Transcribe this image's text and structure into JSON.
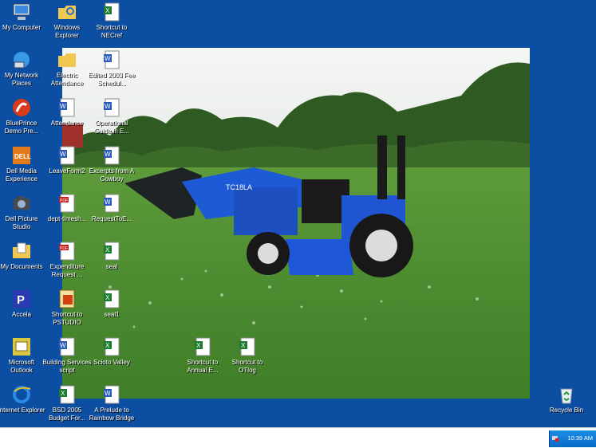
{
  "desktop": {
    "background_color": "#0c4ea2",
    "icons": [
      {
        "id": "my-computer",
        "label": "My Computer",
        "icon": "computer-icon"
      },
      {
        "id": "windows-explorer",
        "label": "Windows Explorer",
        "icon": "explorer-icon"
      },
      {
        "id": "shortcut-necref",
        "label": "Shortcut to NECref",
        "icon": "excel-icon"
      },
      {
        "id": "my-network-places",
        "label": "My Network Places",
        "icon": "network-icon"
      },
      {
        "id": "electric-attendance",
        "label": "Electric Attendance",
        "icon": "folder-icon"
      },
      {
        "id": "edited-2003",
        "label": "Edited 2003 Fee Schedul...",
        "icon": "word-icon"
      },
      {
        "id": "blueprince",
        "label": "BluePrince Demo Pre...",
        "icon": "blueprince-icon"
      },
      {
        "id": "attendance",
        "label": "Attendance",
        "icon": "word-icon"
      },
      {
        "id": "operational-guide",
        "label": "Operational Guide in E...",
        "icon": "word-icon"
      },
      {
        "id": "dell-media",
        "label": "Dell Media Experience",
        "icon": "dell-icon"
      },
      {
        "id": "leaveform2",
        "label": "LeaveForm2",
        "icon": "word-icon"
      },
      {
        "id": "excerpts-cowboy",
        "label": "Excerpts from A Cowboy",
        "icon": "word-icon"
      },
      {
        "id": "dell-picture",
        "label": "Dell Picture Studio",
        "icon": "camera-icon"
      },
      {
        "id": "dept-timesheet",
        "label": "dept-timesh...",
        "icon": "pdf-icon"
      },
      {
        "id": "requesttoe",
        "label": "RequestToE...",
        "icon": "word-icon"
      },
      {
        "id": "my-documents",
        "label": "My Documents",
        "icon": "documents-folder-icon"
      },
      {
        "id": "expenditure-request",
        "label": "Expenditure Request ...",
        "icon": "pdf-icon"
      },
      {
        "id": "seal",
        "label": "seal",
        "icon": "excel-icon"
      },
      {
        "id": "accela",
        "label": "Accela",
        "icon": "accela-icon"
      },
      {
        "id": "shortcut-pstudio",
        "label": "Shortcut to PSTUDIO",
        "icon": "pstudio-icon"
      },
      {
        "id": "seal1",
        "label": "seal1",
        "icon": "excel-icon"
      },
      {
        "id": "microsoft-outlook",
        "label": "Microsoft Outlook",
        "icon": "outlook-icon"
      },
      {
        "id": "building-services",
        "label": "Building Services script",
        "icon": "word-icon"
      },
      {
        "id": "scioto-valley",
        "label": "Scioto Valley",
        "icon": "excel-icon"
      },
      {
        "id": "shortcut-annual",
        "label": "Shortcut to Annual E...",
        "icon": "excel-icon"
      },
      {
        "id": "shortcut-otlog",
        "label": "Shortcut to OTlog",
        "icon": "excel-icon"
      },
      {
        "id": "internet-explorer",
        "label": "Internet Explorer",
        "icon": "ie-icon"
      },
      {
        "id": "bsd-2005",
        "label": "BSD 2005 Budget For...",
        "icon": "excel-icon"
      },
      {
        "id": "prelude-rainbow",
        "label": "A Prelude to Rainbow Bridge",
        "icon": "word-icon"
      },
      {
        "id": "recycle-bin",
        "label": "Recycle Bin",
        "icon": "recycle-bin-icon"
      }
    ]
  },
  "taskbar": {
    "clock": "10:39 AM",
    "tray_icon": "network-alert-icon"
  }
}
